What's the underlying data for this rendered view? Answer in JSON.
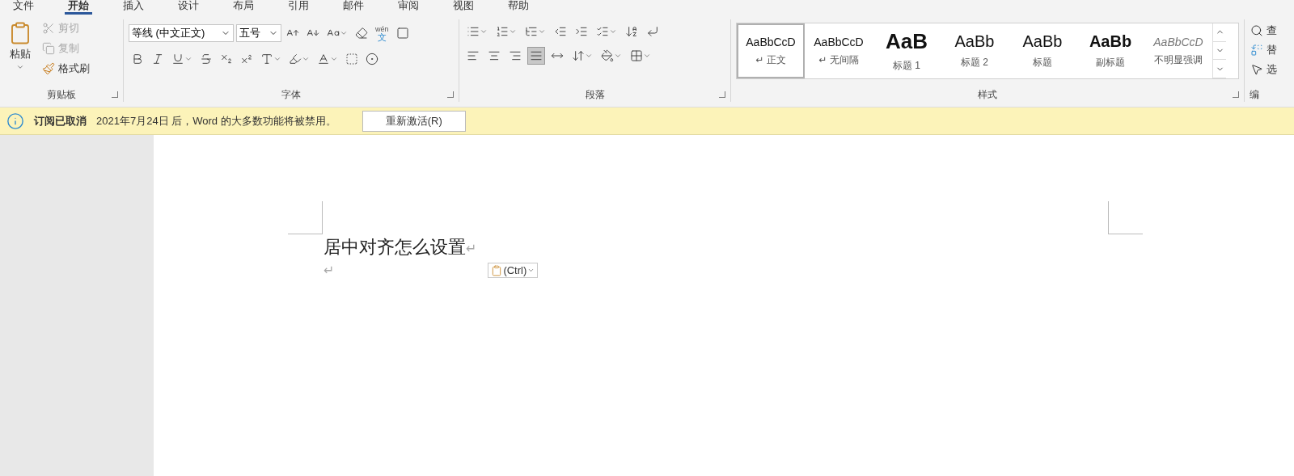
{
  "tabs": [
    {
      "label": "文件",
      "selected": false
    },
    {
      "label": "开始",
      "selected": true
    },
    {
      "label": "插入",
      "selected": false
    },
    {
      "label": "设计",
      "selected": false
    },
    {
      "label": "布局",
      "selected": false
    },
    {
      "label": "引用",
      "selected": false
    },
    {
      "label": "邮件",
      "selected": false
    },
    {
      "label": "审阅",
      "selected": false
    },
    {
      "label": "视图",
      "selected": false
    },
    {
      "label": "帮助",
      "selected": false
    }
  ],
  "clipboard": {
    "paste": "粘贴",
    "group_label": "剪贴板",
    "items": [
      {
        "kind": "cut",
        "label": "剪切",
        "disabled": true
      },
      {
        "kind": "copy",
        "label": "复制",
        "disabled": true
      },
      {
        "kind": "painter",
        "label": "格式刷",
        "disabled": false
      }
    ]
  },
  "font": {
    "font_name": "等线 (中文正文)",
    "font_size": "五号",
    "pinyin": "wén",
    "pinyin_char": "文",
    "group_label": "字体"
  },
  "paragraph": {
    "group_label": "段落",
    "alignments": [
      {
        "kind": "left",
        "selected": false
      },
      {
        "kind": "center",
        "selected": false
      },
      {
        "kind": "right",
        "selected": false
      },
      {
        "kind": "justify",
        "selected": true
      },
      {
        "kind": "distributed",
        "selected": false
      }
    ]
  },
  "styles": {
    "group_label": "样式",
    "items": [
      {
        "kind": "normal",
        "preview": "AaBbCcD",
        "name": "↵ 正文",
        "selected": true
      },
      {
        "kind": "normal",
        "preview": "AaBbCcD",
        "name": "↵ 无间隔",
        "selected": false
      },
      {
        "kind": "heading1",
        "preview": "AaB",
        "name": "标题 1",
        "selected": false
      },
      {
        "kind": "heading2",
        "preview": "AaBb",
        "name": "标题 2",
        "selected": false
      },
      {
        "kind": "title",
        "preview": "AaBb",
        "name": "标题",
        "selected": false
      },
      {
        "kind": "subtitle",
        "preview": "AaBb",
        "name": "副标题",
        "selected": false
      },
      {
        "kind": "subtle",
        "preview": "AaBbCcD",
        "name": "不明显强调",
        "selected": false
      }
    ]
  },
  "editing": {
    "find": "查",
    "replace": "替",
    "select": "选",
    "group_label": "编"
  },
  "notice": {
    "title": "订阅已取消",
    "message": "2021年7月24日 后，Word 的大多数功能将被禁用。",
    "button": "重新激活(R)"
  },
  "document": {
    "heading": "居中对齐怎么设置",
    "marks": [
      "↵",
      "↵"
    ],
    "paste_options": "(Ctrl)"
  }
}
